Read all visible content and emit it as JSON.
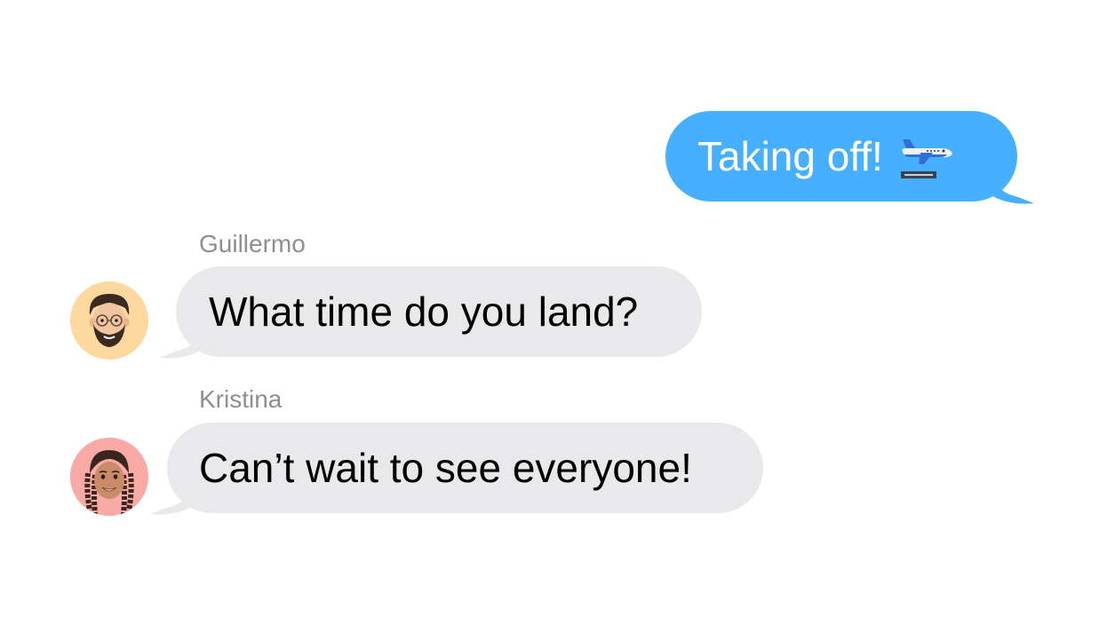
{
  "messages": [
    {
      "direction": "outgoing",
      "text": "Taking off!",
      "emoji": "airplane-departure-icon",
      "bubble_color": "#47afff",
      "text_color": "#ffffff"
    },
    {
      "direction": "incoming",
      "sender": "Guillermo",
      "text": "What time do you land?",
      "avatar": "memoji-guillermo",
      "avatar_bg": "#fdd9a0",
      "bubble_color": "#e9e9eb"
    },
    {
      "direction": "incoming",
      "sender": "Kristina",
      "text": "Can’t wait to see everyone!",
      "avatar": "memoji-kristina",
      "avatar_bg": "#f9a9a6",
      "bubble_color": "#e9e9eb"
    }
  ]
}
